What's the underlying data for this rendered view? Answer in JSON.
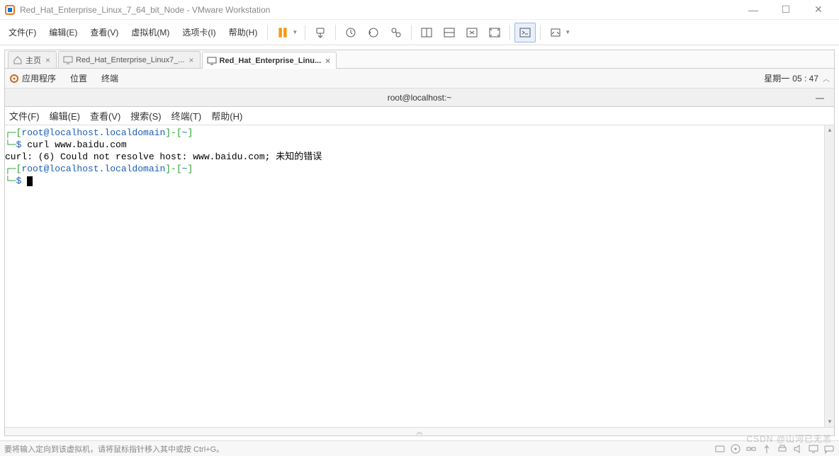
{
  "window": {
    "title": "Red_Hat_Enterprise_Linux_7_64_bit_Node - VMware Workstation"
  },
  "menubar": {
    "items": [
      "文件(F)",
      "编辑(E)",
      "查看(V)",
      "虚拟机(M)",
      "选项卡(I)",
      "帮助(H)"
    ]
  },
  "tabs": {
    "items": [
      {
        "label": "主页",
        "kind": "home"
      },
      {
        "label": "Red_Hat_Enterprise_Linux7_...",
        "kind": "vm"
      },
      {
        "label": "Red_Hat_Enterprise_Linu...",
        "kind": "vm",
        "active": true
      }
    ]
  },
  "vm_topbar": {
    "apps": "应用程序",
    "places": "位置",
    "terminal": "终端",
    "day": "星期一",
    "time": "05 : 47"
  },
  "terminal_title": "root@localhost:~",
  "terminal_menu": [
    "文件(F)",
    "编辑(E)",
    "查看(V)",
    "搜索(S)",
    "终端(T)",
    "帮助(H)"
  ],
  "terminal_output": {
    "prompt_user": "root@localhost.localdomain",
    "prompt_path": "~",
    "cmd1": "curl www.baidu.com",
    "out1": "curl: (6) Could not resolve host: www.baidu.com; 未知的错误"
  },
  "statusbar": {
    "hint": "要将输入定向到该虚拟机，请将鼠标指针移入其中或按 Ctrl+G。"
  },
  "watermark": "CSDN @山河已无恙"
}
